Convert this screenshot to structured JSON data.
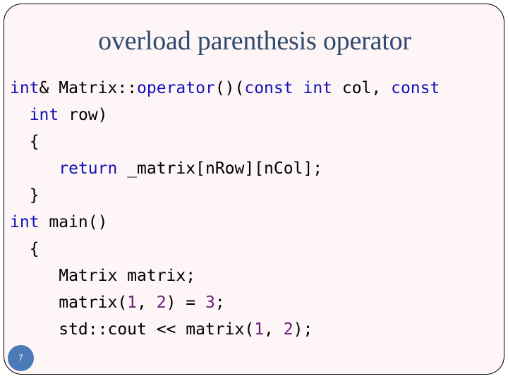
{
  "slide": {
    "title": "overload parenthesis operator",
    "page_number": "7",
    "colors": {
      "background": "#fef6f6",
      "title": "#2e4a6e",
      "keyword": "#1010b8",
      "number": "#6b1a7a",
      "badge": "#4a7ab8"
    },
    "code_lines": [
      [
        {
          "t": "int",
          "c": "kw"
        },
        {
          "t": "& Matrix::",
          "c": ""
        },
        {
          "t": "operator",
          "c": "kw"
        },
        {
          "t": "()(",
          "c": ""
        },
        {
          "t": "const",
          "c": "kw"
        },
        {
          "t": " ",
          "c": ""
        },
        {
          "t": "int",
          "c": "kw"
        },
        {
          "t": " col, ",
          "c": ""
        },
        {
          "t": "const",
          "c": "kw"
        }
      ],
      [
        {
          "t": "  ",
          "c": ""
        },
        {
          "t": "int",
          "c": "kw"
        },
        {
          "t": " row)",
          "c": ""
        }
      ],
      [
        {
          "t": "  {",
          "c": ""
        }
      ],
      [
        {
          "t": "     ",
          "c": ""
        },
        {
          "t": "return",
          "c": "kw"
        },
        {
          "t": " _matrix[nRow][nCol];",
          "c": ""
        }
      ],
      [
        {
          "t": "  }",
          "c": ""
        }
      ],
      [
        {
          "t": "int",
          "c": "kw"
        },
        {
          "t": " main()",
          "c": ""
        }
      ],
      [
        {
          "t": "  {",
          "c": ""
        }
      ],
      [
        {
          "t": "     Matrix matrix;",
          "c": ""
        }
      ],
      [
        {
          "t": "     matrix(",
          "c": ""
        },
        {
          "t": "1",
          "c": "num"
        },
        {
          "t": ", ",
          "c": ""
        },
        {
          "t": "2",
          "c": "num"
        },
        {
          "t": ") = ",
          "c": ""
        },
        {
          "t": "3",
          "c": "num"
        },
        {
          "t": ";",
          "c": ""
        }
      ],
      [
        {
          "t": "     std::cout << matrix(",
          "c": ""
        },
        {
          "t": "1",
          "c": "num"
        },
        {
          "t": ", ",
          "c": ""
        },
        {
          "t": "2",
          "c": "num"
        },
        {
          "t": ");",
          "c": ""
        }
      ]
    ]
  }
}
